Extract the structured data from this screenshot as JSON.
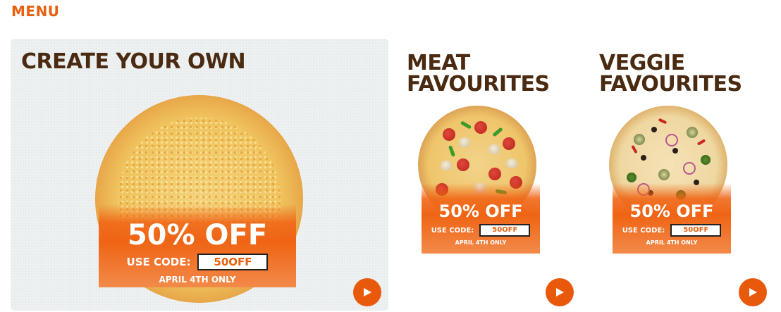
{
  "page": {
    "heading": "MENU"
  },
  "cards": [
    {
      "title": "CREATE YOUR OWN",
      "promo": {
        "discount": "50% OFF",
        "code_label": "USE CODE:",
        "code": "50OFF",
        "date": "APRIL 4TH ONLY"
      },
      "pizza_icon": "cheese-pizza-image",
      "action_icon": "play-icon"
    },
    {
      "title": "MEAT\nFAVOURITES",
      "promo": {
        "discount": "50% OFF",
        "code_label": "USE CODE:",
        "code": "50OFF",
        "date": "APRIL 4TH ONLY"
      },
      "pizza_icon": "meat-pizza-image",
      "action_icon": "play-icon"
    },
    {
      "title": "VEGGIE\nFAVOURITES",
      "promo": {
        "discount": "50% OFF",
        "code_label": "USE CODE:",
        "code": "50OFF",
        "date": "APRIL 4TH ONLY"
      },
      "pizza_icon": "veggie-pizza-image",
      "action_icon": "play-icon"
    }
  ],
  "colors": {
    "accent": "#e8600c",
    "title": "#4a2a10",
    "play_button": "#e8590c",
    "featured_bg": "#eef1f2"
  }
}
